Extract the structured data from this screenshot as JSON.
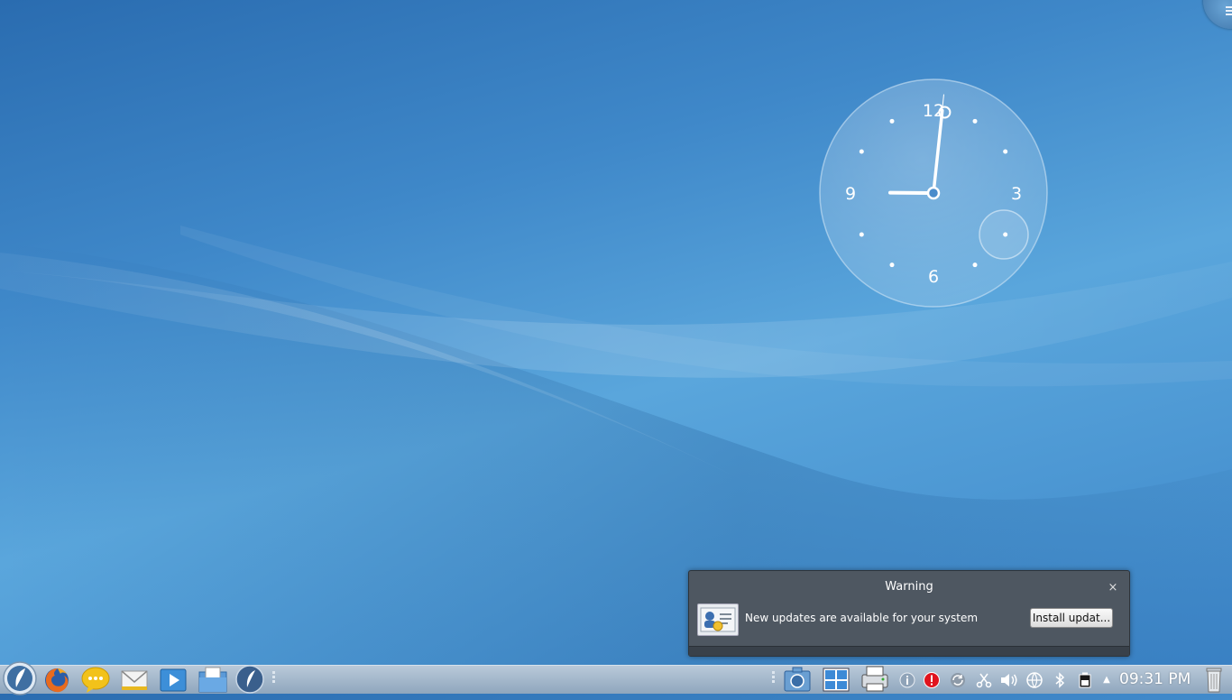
{
  "clock": {
    "numerals": {
      "twelve": "12",
      "three": "3",
      "six": "6",
      "nine": "9"
    },
    "displayed_time": {
      "hour": 9,
      "minute": 1,
      "second": 1
    }
  },
  "notification": {
    "title": "Warning",
    "message": "New updates are available for your system",
    "action_label": "Install updat...",
    "close_glyph": "×"
  },
  "taskbar": {
    "launchers": [
      "app-launcher-icon",
      "firefox-icon",
      "chat-icon",
      "mail-icon",
      "media-player-icon",
      "file-manager-icon",
      "mandriva-icon"
    ],
    "tray_icons": [
      "screenshot-icon",
      "desktop-pager-icon",
      "printer-icon",
      "info-icon",
      "error-icon",
      "sync-icon",
      "scissors-icon",
      "volume-icon",
      "network-icon",
      "bluetooth-icon",
      "battery-icon",
      "tray-expand-icon"
    ],
    "time": "09:31 PM",
    "trash_icon": "trash-icon"
  },
  "colors": {
    "desktop_top": "#2a6cb0",
    "desktop_mid": "#5aa6dc",
    "notification_bg": "#4e5761",
    "taskbar_top": "#b9c9d9",
    "taskbar_bottom": "#8fa6bd"
  }
}
